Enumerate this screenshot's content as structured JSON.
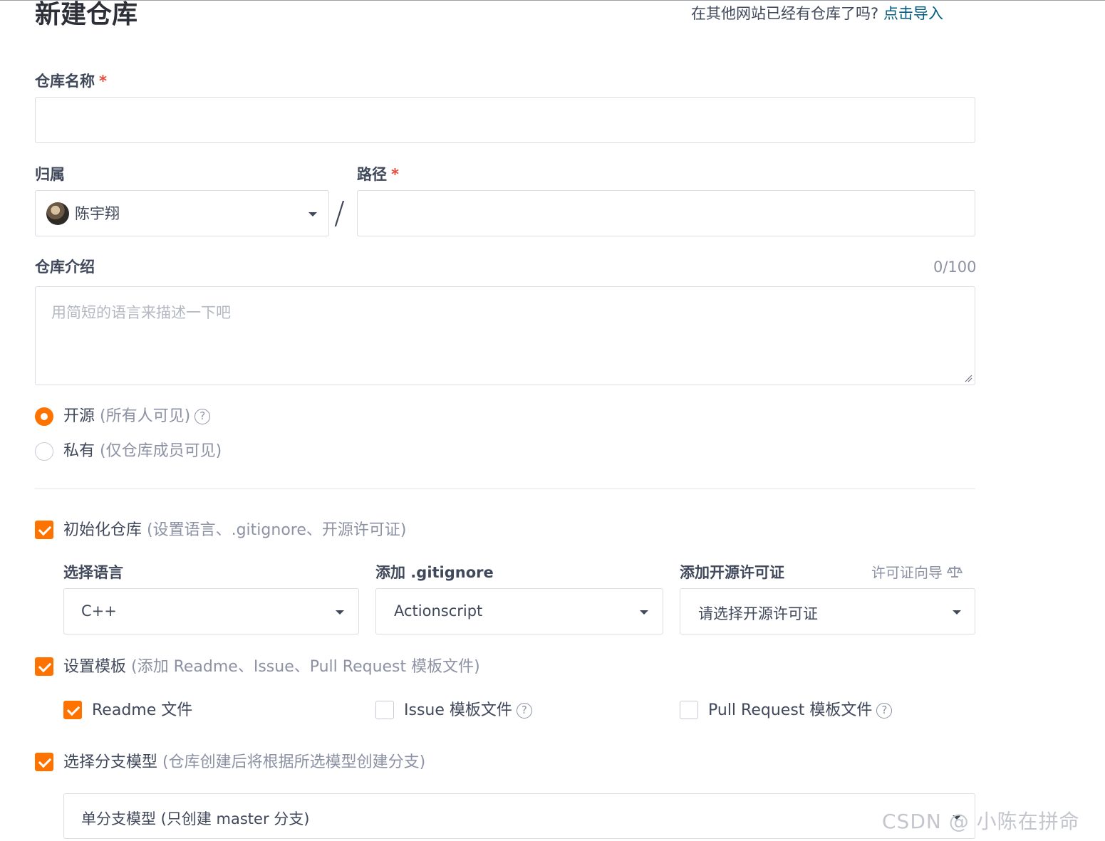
{
  "header": {
    "title": "新建仓库",
    "import_prompt": "在其他网站已经有仓库了吗?",
    "import_link": "点击导入"
  },
  "repo_name": {
    "label": "仓库名称",
    "required_mark": "*",
    "value": ""
  },
  "owner": {
    "label": "归属",
    "value": "陈宇翔"
  },
  "separator": "/",
  "path": {
    "label": "路径",
    "required_mark": "*",
    "value": ""
  },
  "description": {
    "label": "仓库介绍",
    "counter": "0/100",
    "placeholder": "用简短的语言来描述一下吧",
    "value": ""
  },
  "visibility": {
    "selected": "public",
    "public_label": "开源",
    "public_hint": "(所有人可见)",
    "private_label": "私有",
    "private_hint": "(仅仓库成员可见)"
  },
  "init_repo": {
    "checked": true,
    "label": "初始化仓库",
    "hint": "(设置语言、.gitignore、开源许可证)",
    "language": {
      "label": "选择语言",
      "value": "C++"
    },
    "gitignore": {
      "label": "添加 .gitignore",
      "value": "Actionscript"
    },
    "license": {
      "label": "添加开源许可证",
      "guide": "许可证向导",
      "value": "请选择开源许可证"
    }
  },
  "templates": {
    "checked": true,
    "label": "设置模板",
    "hint": "(添加 Readme、Issue、Pull Request 模板文件)",
    "readme": {
      "checked": true,
      "label": "Readme 文件"
    },
    "issue": {
      "checked": false,
      "label": "Issue 模板文件"
    },
    "pull_request": {
      "checked": false,
      "label": "Pull Request 模板文件"
    }
  },
  "branch_model": {
    "checked": true,
    "label": "选择分支模型",
    "hint": "(仓库创建后将根据所选模型创建分支)",
    "value": "单分支模型 (只创建 master 分支)"
  },
  "watermark": "CSDN @ 小陈在拼命",
  "colors": {
    "accent": "#fe7300",
    "link": "#005980",
    "required": "#e84b3c",
    "text": "#40485b",
    "muted": "#8c92a4",
    "border": "#dadde3"
  }
}
